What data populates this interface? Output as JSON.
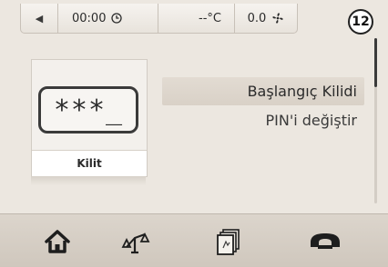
{
  "status_bar": {
    "time": "00:00",
    "temperature": "--°C",
    "fan": "0.0",
    "icons": [
      "back-arrow-icon",
      "clock-icon",
      "fan-icon"
    ]
  },
  "badge": "12",
  "lock_tile": {
    "pin_display": "***_",
    "label": "Kilit"
  },
  "menu": {
    "items": [
      {
        "label": "Başlangıç Kilidi",
        "selected": true
      },
      {
        "label": "PIN'i değiştir",
        "selected": false
      }
    ]
  },
  "bottom_bar": {
    "icons": [
      "home-icon",
      "scales-icon",
      "cards-icon",
      "car-icon"
    ]
  },
  "colors": {
    "background": "#ece7e0",
    "selected_row": "#ddd5cb",
    "bottom_bar": "#d5cdc3"
  }
}
